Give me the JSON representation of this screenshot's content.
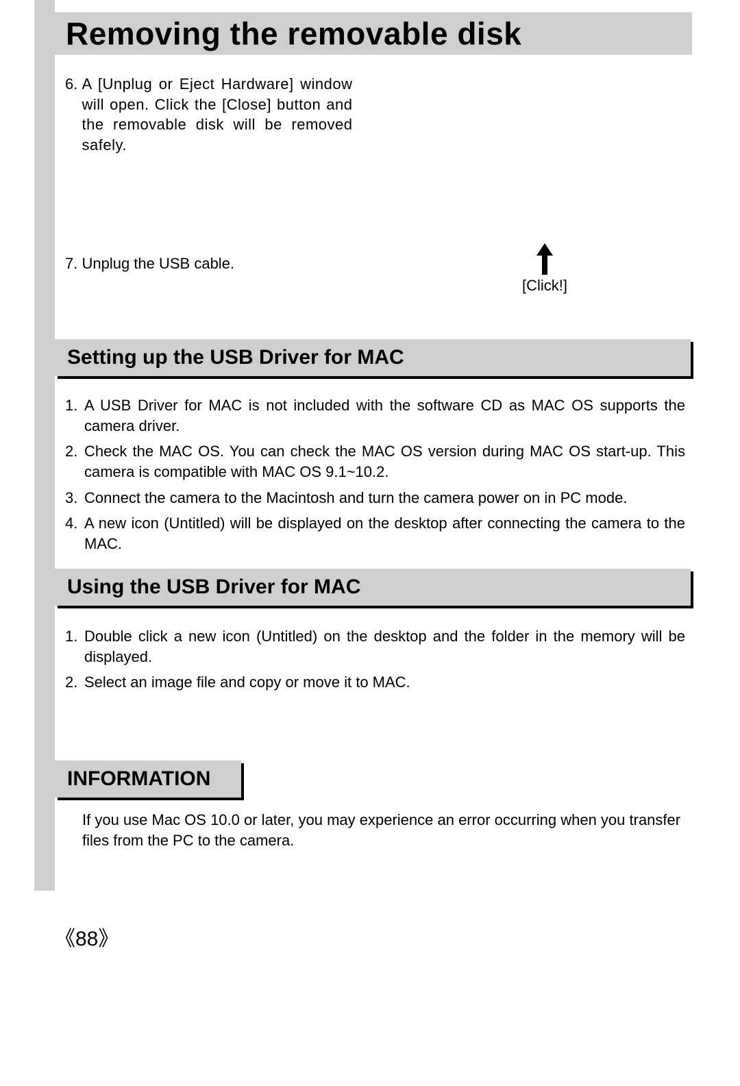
{
  "title": "Removing the removable disk",
  "steps_top": {
    "s6_num": "6.",
    "s6_text": "A [Unplug or Eject Hardware] window will open. Click the [Close] button and the removable disk will be removed safely.",
    "s7_text": "7. Unplug the USB cable."
  },
  "click_label": "[Click!]",
  "section_setup": {
    "title": "Setting up the USB Driver for MAC",
    "items": [
      "A USB Driver for MAC is not included with the software CD as MAC OS supports the camera driver.",
      "Check the MAC OS. You can check the MAC OS version during MAC OS start-up. This camera is compatible with MAC OS 9.1~10.2.",
      "Connect the camera to the Macintosh and turn the camera power on in PC mode.",
      "A new icon (Untitled) will be displayed on the desktop after connecting the camera to the MAC."
    ]
  },
  "section_using": {
    "title": "Using the USB Driver for MAC",
    "items": [
      "Double click a new icon (Untitled) on the desktop and the folder in the memory will be displayed.",
      "Select an image file and copy or move it to MAC."
    ]
  },
  "section_info": {
    "title": "INFORMATION",
    "text": "If you use Mac OS 10.0 or later, you may experience an error occurring when you transfer files from the PC to the camera."
  },
  "page_number": "88"
}
